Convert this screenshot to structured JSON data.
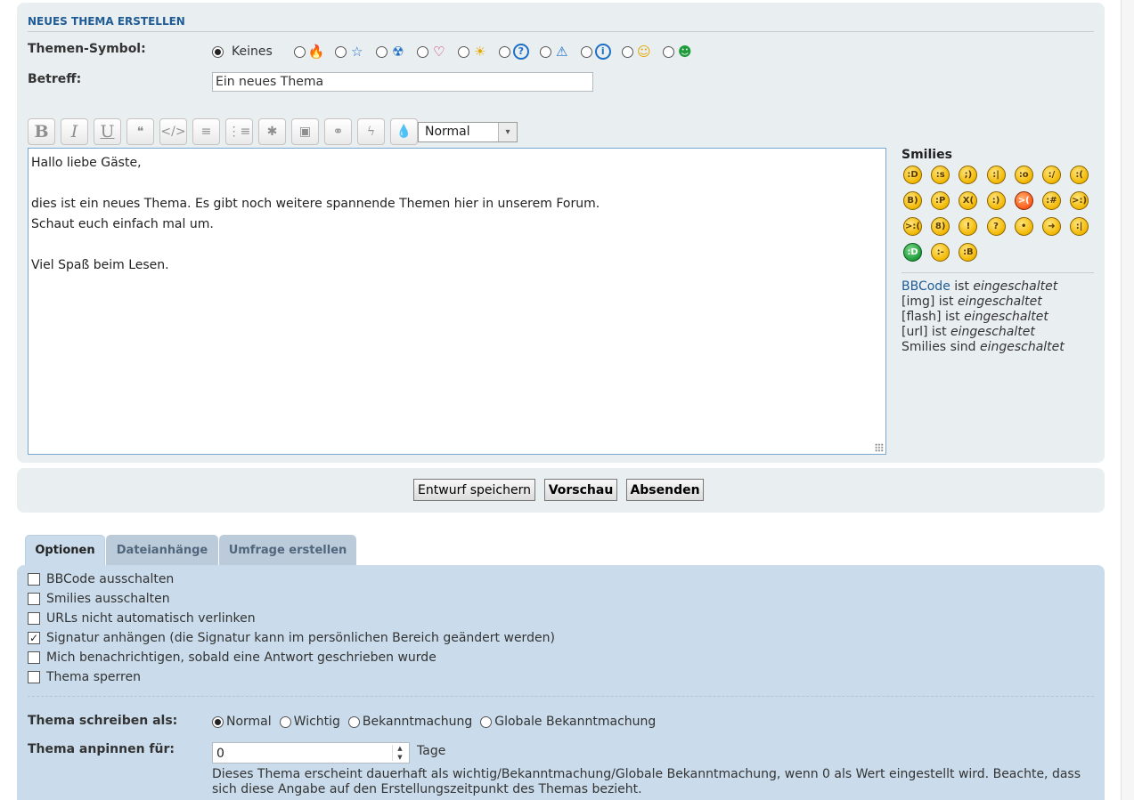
{
  "section_title": "NEUES THEMA ERSTELLEN",
  "icon_row": {
    "label": "Themen-Symbol:",
    "none_label": "Keines",
    "icons": [
      "flame-icon",
      "star-icon",
      "radioactive-icon",
      "heart-icon",
      "sun-icon",
      "question-icon",
      "warning-icon",
      "info-icon",
      "smiley-wink-icon",
      "smiley-grin-icon"
    ],
    "icon_glyphs": [
      "🔥",
      "☆",
      "☢",
      "♡",
      "☀",
      "?",
      "⚠",
      "i",
      "☺",
      "☻"
    ],
    "icon_colors": [
      "#f08a2a",
      "#1f6fc4",
      "#1f6fc4",
      "#d0214a",
      "#e6a800",
      "#1f6fc4",
      "#1f6fc4",
      "#1f6fc4",
      "#e6a800",
      "#1d9c3a"
    ]
  },
  "subject": {
    "label": "Betreff:",
    "value": "Ein neues Thema"
  },
  "toolbar": {
    "buttons": [
      "B",
      "I",
      "U",
      "❝",
      "</>",
      "≡",
      "⋮≡",
      "✱",
      "▣",
      "⚭",
      "ϟ",
      "💧"
    ],
    "font_size": "Normal"
  },
  "editor": {
    "lines": [
      "Hallo liebe Gäste,",
      "",
      "dies ist ein neues Thema. Es gibt noch weitere spannende Themen hier in unserem Forum.",
      "Schaut euch einfach mal um.",
      "",
      "Viel Spaß beim Lesen."
    ]
  },
  "smilies": {
    "title": "Smilies",
    "items": [
      "😄",
      "😏",
      "😉",
      "😐",
      "😮",
      "😕",
      "🙁",
      "😎",
      "😛",
      "😵",
      "😀",
      "😡",
      "😬",
      "😈",
      "👿",
      "🙄",
      "!",
      "?",
      "💡",
      "➜",
      "😐",
      "😁",
      "😑",
      "🤓"
    ],
    "faces": [
      ":D",
      ":s",
      ";)",
      ":|",
      ":o",
      ":/",
      ":(",
      "B)",
      ":P",
      "X(",
      ":)",
      ">(",
      ":#",
      ">:)",
      ">:(",
      "8)",
      "!",
      "?",
      "•",
      "➜",
      ":|",
      ":D",
      ":-",
      ":B"
    ],
    "tints": [
      "y",
      "y",
      "y",
      "y",
      "y",
      "y",
      "y",
      "y",
      "y",
      "y",
      "y",
      "r",
      "y",
      "y",
      "y",
      "y",
      "y",
      "y",
      "y",
      "y",
      "y",
      "g",
      "y",
      "y"
    ]
  },
  "bbinfo": {
    "bbcode_link": "BBCode",
    "is": "ist",
    "enabled": "eingeschaltet",
    "img": "[img]",
    "flash": "[flash]",
    "url": "[url]",
    "smilies": "Smilies",
    "are": "sind"
  },
  "buttons": {
    "draft": "Entwurf speichern",
    "preview": "Vorschau",
    "submit": "Absenden"
  },
  "tabs": [
    "Optionen",
    "Dateianhänge",
    "Umfrage erstellen"
  ],
  "options": [
    {
      "label": "BBCode ausschalten",
      "checked": false
    },
    {
      "label": "Smilies ausschalten",
      "checked": false
    },
    {
      "label": "URLs nicht automatisch verlinken",
      "checked": false
    },
    {
      "label": "Signatur anhängen (die Signatur kann im persönlichen Bereich geändert werden)",
      "checked": true
    },
    {
      "label": "Mich benachrichtigen, sobald eine Antwort geschrieben wurde",
      "checked": false
    },
    {
      "label": "Thema sperren",
      "checked": false
    }
  ],
  "post_type": {
    "label": "Thema schreiben als:",
    "choices": [
      "Normal",
      "Wichtig",
      "Bekanntmachung",
      "Globale Bekanntmachung"
    ],
    "selected": "Normal"
  },
  "pin": {
    "label": "Thema anpinnen für:",
    "value": "0",
    "unit": "Tage",
    "description": "Dieses Thema erscheint dauerhaft als wichtig/Bekanntmachung/Globale Bekanntmachung, wenn 0 als Wert eingestellt wird. Beachte, dass sich diese Angabe auf den Erstellungszeitpunkt des Themas bezieht."
  }
}
